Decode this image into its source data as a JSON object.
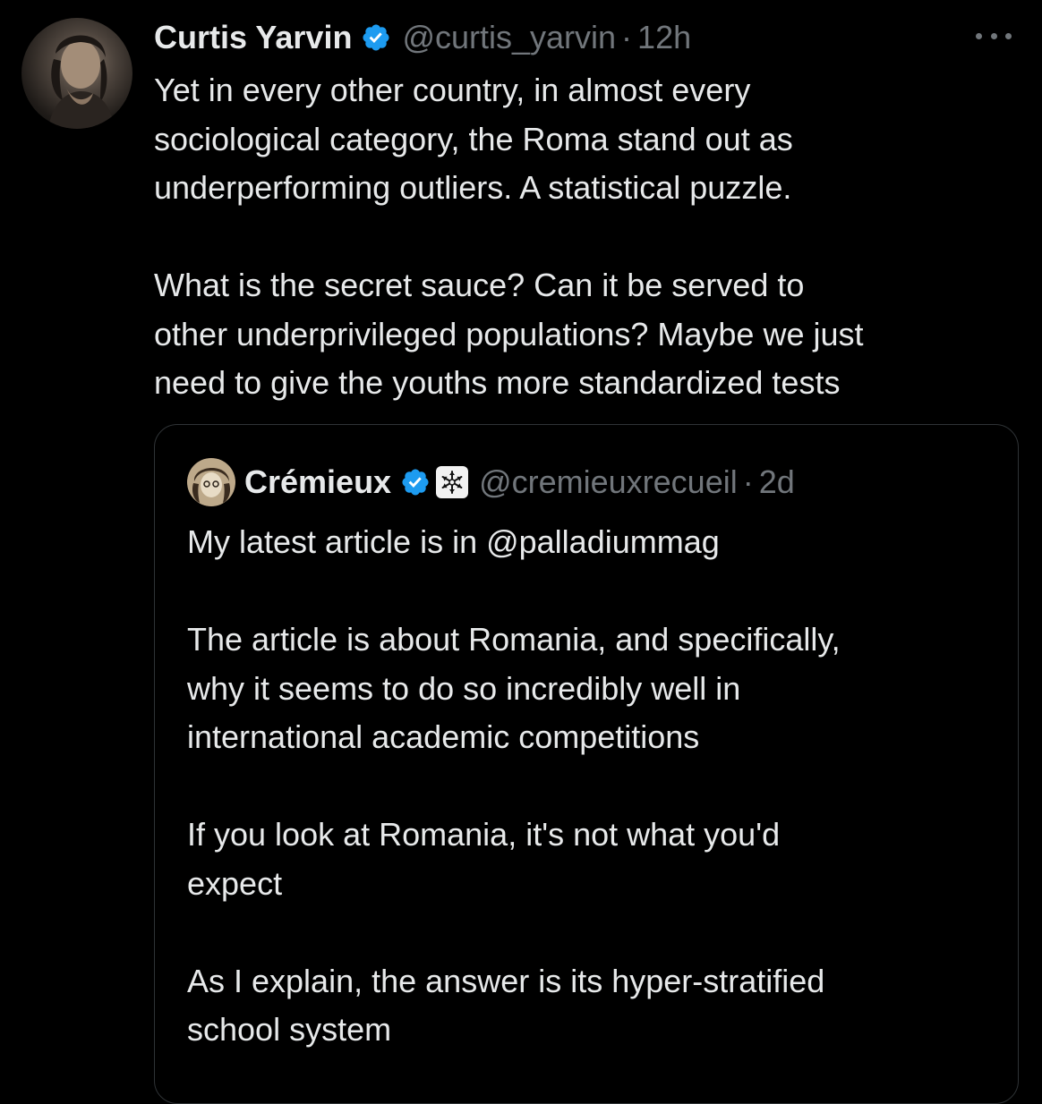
{
  "tweet": {
    "author": {
      "display_name": "Curtis Yarvin",
      "handle": "@curtis_yarvin",
      "time": "12h",
      "separator": "·",
      "verified": true,
      "verified_icon": "verified-badge-icon"
    },
    "more_icon": "more-options-icon",
    "paragraphs": [
      {
        "lines": [
          "Yet in every other country, in almost every",
          "sociological category, the Roma stand out as",
          "underperforming outliers. A statistical puzzle."
        ]
      },
      {
        "lines": [
          "What is the secret sauce? Can it be served to",
          "other underprivileged populations? Maybe we just",
          "need to give the youths more standardized tests"
        ]
      }
    ],
    "quoted": {
      "display_name": "Crémieux",
      "handle": "@cremieuxrecueil",
      "time": "2d",
      "separator": "·",
      "verified": true,
      "affiliate_icon": "affiliate-badge-icon",
      "paragraphs": [
        {
          "lines": [
            "My latest article is in @palladiummag"
          ]
        },
        {
          "lines": [
            "The article is about Romania, and specifically,",
            "why it seems to do so incredibly well in",
            "international academic competitions"
          ]
        },
        {
          "lines": [
            "If you look at Romania, it's not what you'd",
            "expect"
          ]
        },
        {
          "lines": [
            "As I explain, the answer is its hyper-stratified",
            "school system"
          ]
        }
      ]
    }
  },
  "colors": {
    "background": "#000000",
    "text_primary": "#e7e9ea",
    "text_secondary": "#71767b",
    "verified_blue": "#1d9bf0",
    "border": "#2f3336"
  }
}
